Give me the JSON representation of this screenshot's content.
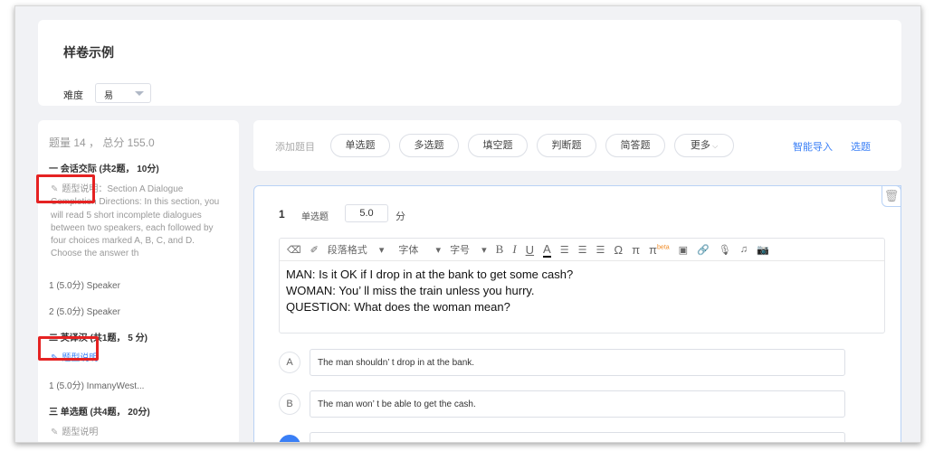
{
  "header": {
    "title": "样卷示例",
    "difficulty_label": "难度",
    "difficulty_value": "易"
  },
  "sidebar": {
    "summary": "题量 14 ， 总分 155.0",
    "sections": [
      {
        "title": "一 会话交际 (共2题， 10分)",
        "desc_label": "题型说明",
        "desc_text": "：Section A Dialogue Completion Directions: In this section, you will read 5 short incomplete dialogues between two speakers, each followed by four choices marked A, B, C, and D. Choose the answer th",
        "items": [
          "1 (5.0分) Speaker",
          "2 (5.0分) Speaker"
        ]
      },
      {
        "title": "二 英译汉 (共1题， 5 分)",
        "desc_label": "题型说明",
        "items": [
          "1 (5.0分) InmanyWest..."
        ]
      },
      {
        "title": "三 单选题 (共4题， 20分)",
        "desc_label": "题型说明"
      }
    ]
  },
  "toolbar": {
    "add_label": "添加题目",
    "types": [
      "单选题",
      "多选题",
      "填空题",
      "判断题",
      "简答题",
      "更多"
    ],
    "smart_import": "智能导入",
    "select": "选题"
  },
  "question": {
    "number": "1",
    "type": "单选题",
    "score": "5.0",
    "unit": "分",
    "editor_toolbar": [
      "段落格式",
      "字体",
      "字号"
    ],
    "beta": "beta",
    "lines": [
      "MAN: Is it OK if I drop in at the bank to get some cash?",
      "WOMAN: You’ ll miss the train unless you hurry.",
      "QUESTION: What does the woman mean?"
    ],
    "options": [
      {
        "letter": "A",
        "text": "The man shouldn’ t drop in at the bank."
      },
      {
        "letter": "B",
        "text": "The man won’ t be able to get the cash."
      }
    ]
  }
}
